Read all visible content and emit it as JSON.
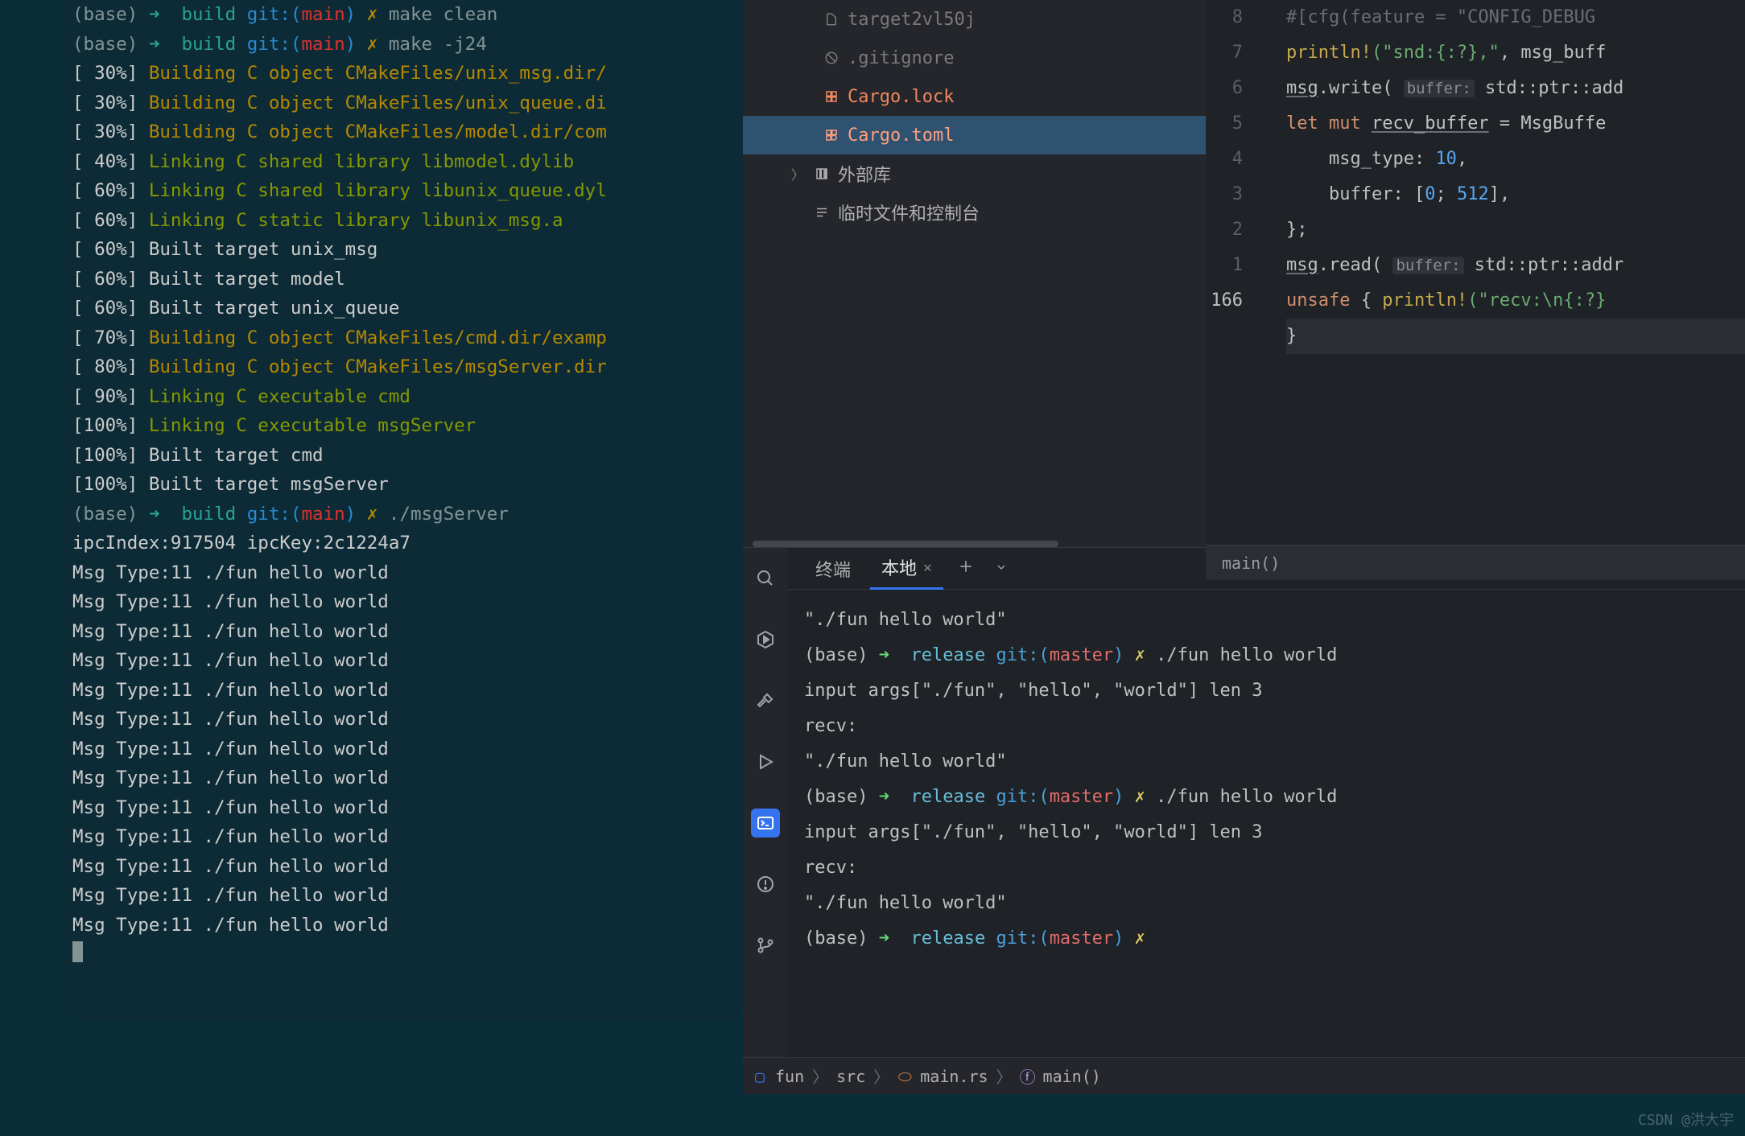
{
  "leftTerminal": {
    "prompt1": {
      "base": "(base)",
      "arrow": "➜",
      "dir": "build",
      "git": "git:(",
      "branch": "main",
      "gitClose": ")",
      "x": "✗",
      "cmd": "make clean"
    },
    "prompt2": {
      "base": "(base)",
      "arrow": "➜",
      "dir": "build",
      "git": "git:(",
      "branch": "main",
      "gitClose": ")",
      "x": "✗",
      "cmd": "make -j24"
    },
    "buildLines": [
      {
        "pct": "[ 30%]",
        "txt": "Building C object CMakeFiles/unix_msg.dir/",
        "cls": "y"
      },
      {
        "pct": "[ 30%]",
        "txt": "Building C object CMakeFiles/unix_queue.di",
        "cls": "y"
      },
      {
        "pct": "[ 30%]",
        "txt": "Building C object CMakeFiles/model.dir/com",
        "cls": "y"
      },
      {
        "pct": "[ 40%]",
        "txt": "Linking C shared library libmodel.dylib",
        "cls": "g"
      },
      {
        "pct": "[ 60%]",
        "txt": "Linking C shared library libunix_queue.dyl",
        "cls": "g"
      },
      {
        "pct": "[ 60%]",
        "txt": "Linking C static library libunix_msg.a",
        "cls": "g"
      },
      {
        "pct": "[ 60%]",
        "txt": "Built target unix_msg",
        "cls": "w"
      },
      {
        "pct": "[ 60%]",
        "txt": "Built target model",
        "cls": "w"
      },
      {
        "pct": "[ 60%]",
        "txt": "Built target unix_queue",
        "cls": "w"
      },
      {
        "pct": "[ 70%]",
        "txt": "Building C object CMakeFiles/cmd.dir/examp",
        "cls": "y"
      },
      {
        "pct": "[ 80%]",
        "txt": "Building C object CMakeFiles/msgServer.dir",
        "cls": "y"
      },
      {
        "pct": "[ 90%]",
        "txt": "Linking C executable cmd",
        "cls": "g"
      },
      {
        "pct": "[100%]",
        "txt": "Linking C executable msgServer",
        "cls": "g"
      },
      {
        "pct": "[100%]",
        "txt": "Built target cmd",
        "cls": "w"
      },
      {
        "pct": "[100%]",
        "txt": "Built target msgServer",
        "cls": "w"
      }
    ],
    "prompt3": {
      "base": "(base)",
      "arrow": "➜",
      "dir": "build",
      "git": "git:(",
      "branch": "main",
      "gitClose": ")",
      "x": "✗",
      "cmd": "./msgServer"
    },
    "ipc": "ipcIndex:917504 ipcKey:2c1224a7",
    "msgLine": "Msg Type:11 ./fun hello world",
    "msgCount": 13
  },
  "fileTree": {
    "items": [
      {
        "name": "target2vl50j",
        "icon": "file",
        "cls": "muted"
      },
      {
        "name": ".gitignore",
        "icon": "ignore",
        "cls": "muted"
      },
      {
        "name": "Cargo.lock",
        "icon": "lock",
        "cls": "orange"
      },
      {
        "name": "Cargo.toml",
        "icon": "toml",
        "cls": "selected"
      }
    ],
    "ext1": "外部库",
    "ext2": "临时文件和控制台"
  },
  "editor": {
    "relNums": [
      "",
      "8",
      "7",
      "6",
      "5",
      "4",
      "3",
      "2",
      "1",
      "166"
    ],
    "lines": {
      "l0": {
        "comment": "#[cfg(feature = \"CONFIG_DEBUG",
        "macro": ""
      },
      "l1": {
        "macro": "println!",
        "str": "(\"snd:{:?},\"",
        "rest": ", msg_buff"
      },
      "l2": {
        "var": "msg",
        "fn": ".write(",
        "param": "buffer:",
        "rest": " std::ptr::add"
      },
      "l3": {
        "kw": "let mut ",
        "var": "recv_buffer",
        "rest": " = MsgBuffe"
      },
      "l4": {
        "field": "msg_type: ",
        "num": "10",
        "rest": ","
      },
      "l5": {
        "field": "buffer: [",
        "num": "0",
        "rest": "; ",
        "num2": "512",
        "close": "],"
      },
      "l6": {
        "txt": "};"
      },
      "l7": {
        "var": "msg",
        "fn": ".read(",
        "param": "buffer:",
        "rest": " std::ptr::addr"
      },
      "l8": {
        "kw": "unsafe ",
        "brace": "{ ",
        "macro": "println!",
        "str": "(\"recv:\\n{:?}"
      },
      "l9": {
        "brace": "}"
      }
    },
    "footer": "main()"
  },
  "terminal": {
    "tabLabel": "终端",
    "tabLocal": "本地",
    "lines": [
      {
        "type": "out",
        "txt": "\"./fun hello world\""
      },
      {
        "type": "prompt",
        "base": "(base)",
        "dir": "release",
        "git": "git:(",
        "branch": "master",
        "gitClose": ")",
        "x": "✗",
        "cmd": "./fun hello world"
      },
      {
        "type": "out",
        "txt": "input args[\"./fun\", \"hello\", \"world\"] len 3"
      },
      {
        "type": "out",
        "txt": "recv:"
      },
      {
        "type": "out",
        "txt": "\"./fun hello world\""
      },
      {
        "type": "prompt",
        "base": "(base)",
        "dir": "release",
        "git": "git:(",
        "branch": "master",
        "gitClose": ")",
        "x": "✗",
        "cmd": "./fun hello world"
      },
      {
        "type": "out",
        "txt": "input args[\"./fun\", \"hello\", \"world\"] len 3"
      },
      {
        "type": "out",
        "txt": "recv:"
      },
      {
        "type": "out",
        "txt": "\"./fun hello world\""
      },
      {
        "type": "prompt",
        "base": "(base)",
        "dir": "release",
        "git": "git:(",
        "branch": "master",
        "gitClose": ")",
        "x": "✗",
        "cmd": ""
      }
    ]
  },
  "breadcrumb": {
    "p1": "fun",
    "p2": "src",
    "p3": "main.rs",
    "p4": "main()"
  },
  "watermark": "CSDN @洪大宇"
}
